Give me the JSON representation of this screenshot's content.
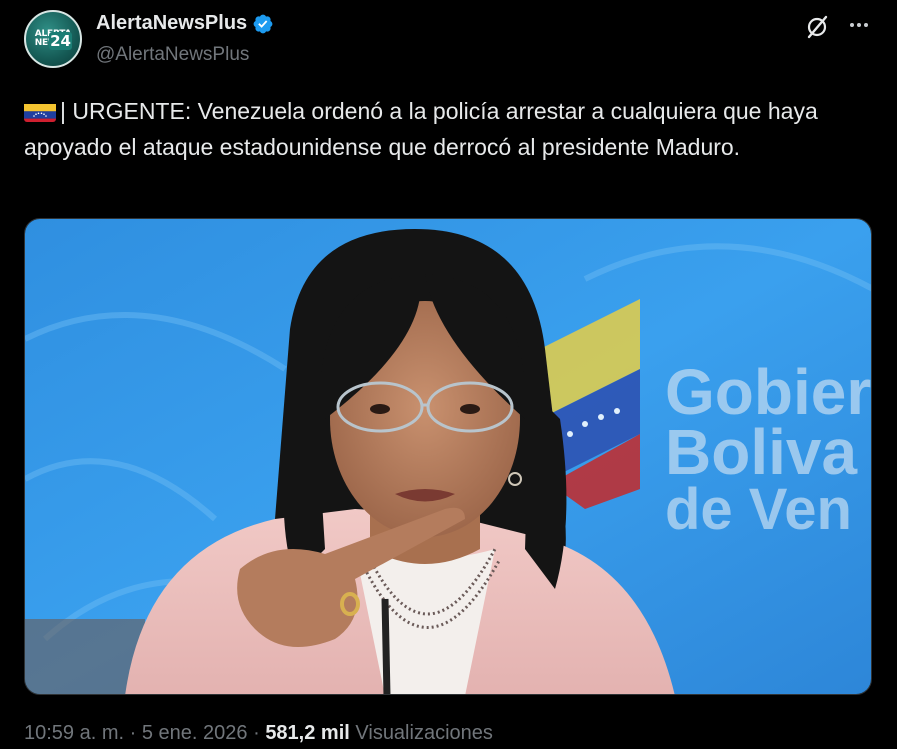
{
  "author": {
    "display_name": "AlertaNewsPlus",
    "handle": "@AlertaNewsPlus",
    "verified": true,
    "avatar": {
      "line1": "ALERTA",
      "line2": "NEWS",
      "number": "24"
    }
  },
  "icons": {
    "verified": "verified-badge-icon",
    "grok": "grok-icon",
    "more": "more-options-icon",
    "flag": "venezuela-flag-icon"
  },
  "tweet": {
    "text": "| URGENTE: Venezuela ordenó a la policía arrestar a cualquiera que haya apoyado el ataque estadounidense que derrocó al presidente Maduro."
  },
  "media": {
    "background_sign_lines": [
      "Gobier",
      "Boliva",
      "de Ven"
    ]
  },
  "footer": {
    "time": "10:59 a. m.",
    "separator": "·",
    "date": "5 ene. 2026",
    "views_count": "581,2 mil",
    "views_label": "Visualizaciones"
  },
  "colors": {
    "background": "#000000",
    "text": "#e7e9ea",
    "secondary": "#71767b",
    "verified": "#1d9bf0",
    "flag_yellow": "#f4c430",
    "flag_blue": "#1f3fa0",
    "flag_red": "#cf1f2f"
  }
}
